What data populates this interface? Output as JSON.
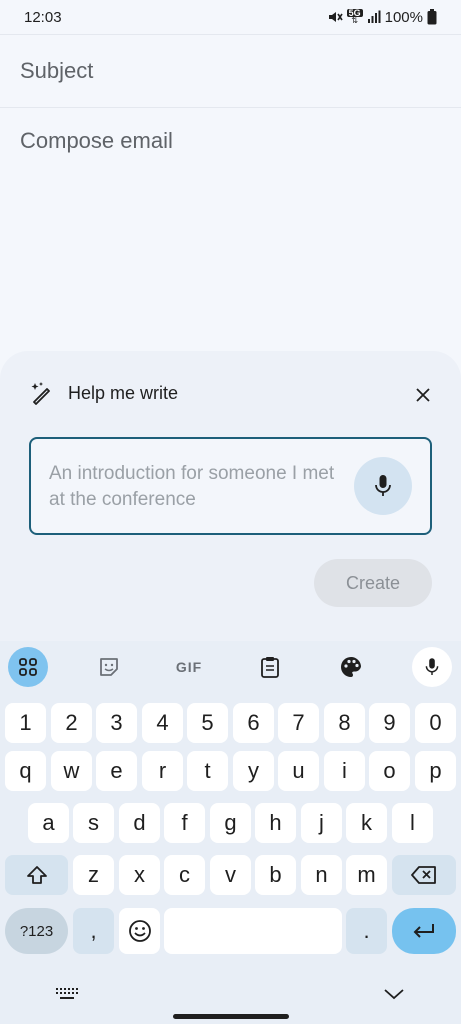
{
  "status": {
    "time": "12:03",
    "network": "5G",
    "battery": "100%"
  },
  "compose": {
    "subject_placeholder": "Subject",
    "body_placeholder": "Compose email"
  },
  "help_me_write": {
    "title": "Help me write",
    "prompt_placeholder": "An introduction for someone I met at the conference",
    "create_label": "Create"
  },
  "keyboard": {
    "toolbar_gif": "GIF",
    "row_numbers": [
      "1",
      "2",
      "3",
      "4",
      "5",
      "6",
      "7",
      "8",
      "9",
      "0"
    ],
    "row_1": [
      "q",
      "w",
      "e",
      "r",
      "t",
      "y",
      "u",
      "i",
      "o",
      "p"
    ],
    "row_2": [
      "a",
      "s",
      "d",
      "f",
      "g",
      "h",
      "j",
      "k",
      "l"
    ],
    "row_3": [
      "z",
      "x",
      "c",
      "v",
      "b",
      "n",
      "m"
    ],
    "symbols_label": "?123",
    "comma": ",",
    "period": "."
  },
  "colors": {
    "accent": "#1d5f7a",
    "key_enter": "#76c2ef",
    "sheet_bg": "#edf1f8"
  }
}
